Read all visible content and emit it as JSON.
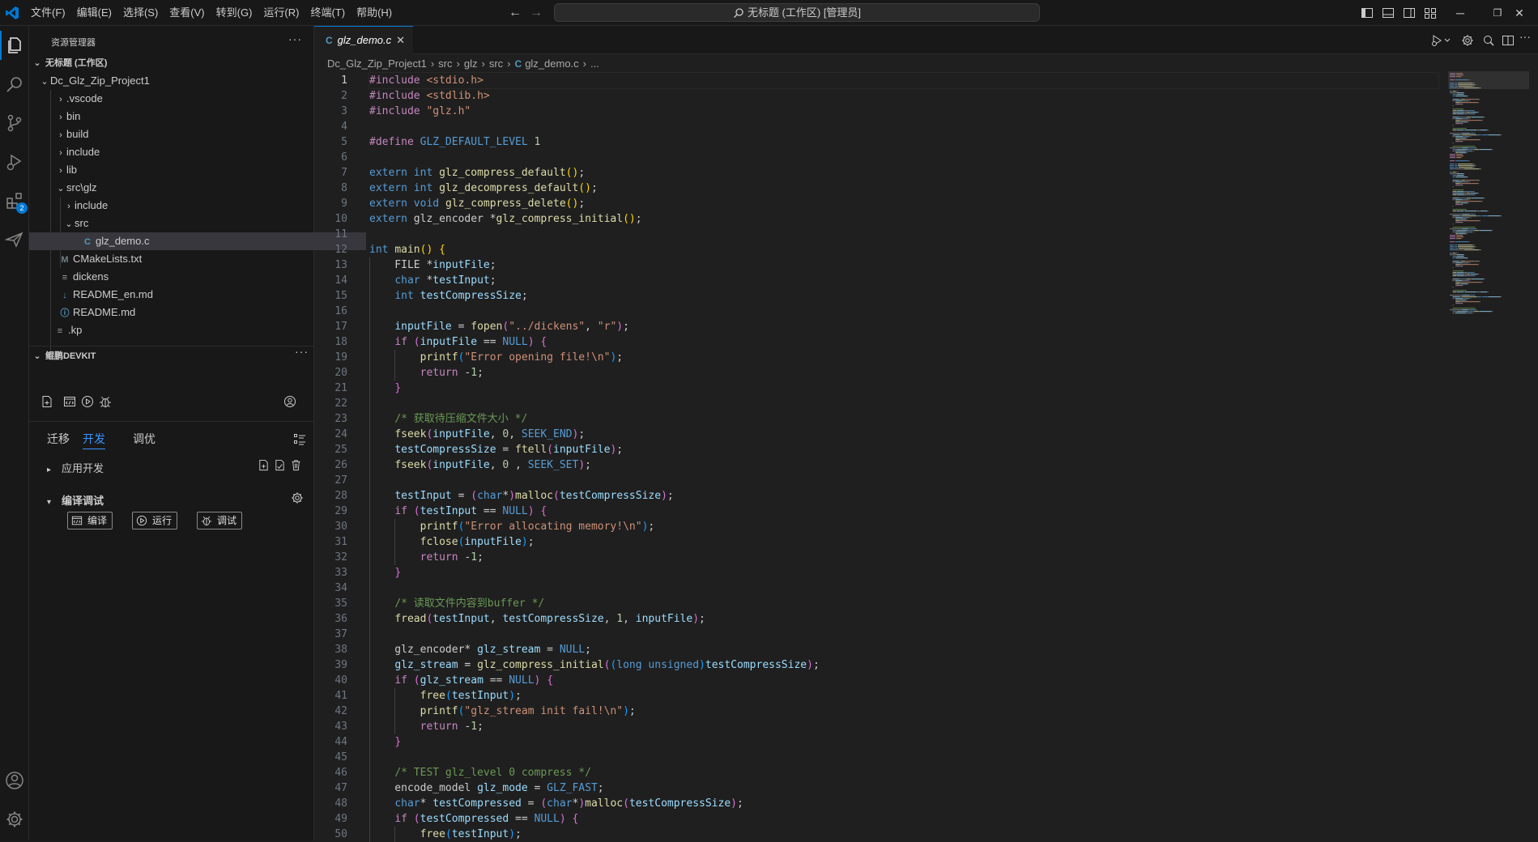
{
  "titlebar": {
    "menus": [
      "文件(F)",
      "编辑(E)",
      "选择(S)",
      "查看(V)",
      "转到(G)",
      "运行(R)",
      "终端(T)",
      "帮助(H)"
    ],
    "command_center": "无标题 (工作区) [管理员]"
  },
  "activitybar": {
    "extensions_badge": "2"
  },
  "explorer": {
    "title": "资源管理器",
    "more": "···",
    "workspace": "无标题 (工作区)",
    "rows": [
      {
        "label": "Dc_Glz_Zip_Project1"
      },
      {
        "label": ".vscode"
      },
      {
        "label": "bin"
      },
      {
        "label": "build"
      },
      {
        "label": "include"
      },
      {
        "label": "lib"
      },
      {
        "label": "src\\glz"
      },
      {
        "label": "include"
      },
      {
        "label": "src"
      },
      {
        "label": "glz_demo.c",
        "icon": "C"
      },
      {
        "label": "CMakeLists.txt",
        "icon": "M"
      },
      {
        "label": "dickens",
        "icon": "≡"
      },
      {
        "label": "README_en.md",
        "icon": "↓"
      },
      {
        "label": "README.md",
        "icon": "ⓘ"
      },
      {
        "label": ".kp",
        "icon": "≡"
      }
    ]
  },
  "devkit": {
    "title": "鲲鹏DEVKIT",
    "more": "···",
    "tabs": [
      "迁移",
      "开发",
      "调优"
    ],
    "app_dev": "应用开发",
    "compile_debug": "编译调试",
    "buttons": {
      "compile": "编译",
      "run": "运行",
      "debug": "调试"
    }
  },
  "editor": {
    "tab_lang": "C",
    "tab_name": "glz_demo.c",
    "tab_close": "✕",
    "breadcrumbs": [
      "Dc_Glz_Zip_Project1",
      "src",
      "glz",
      "src",
      "glz_demo.c",
      "..."
    ],
    "breadcrumb_sep": "›",
    "current_line": 1,
    "line_count": 50
  },
  "colors": {
    "accent": "#0078d4",
    "keyword": "#569cd6",
    "control": "#c586c0",
    "string": "#ce9178",
    "function": "#dcdcaa",
    "comment": "#6a9955",
    "number": "#b5cea8"
  },
  "code": [
    [
      [
        "#include",
        "ct"
      ],
      [
        " ",
        ""
      ],
      [
        "<stdio.h>",
        "str"
      ]
    ],
    [
      [
        "#include",
        "ct"
      ],
      [
        " ",
        ""
      ],
      [
        "<stdlib.h>",
        "str"
      ]
    ],
    [
      [
        "#include",
        "ct"
      ],
      [
        " ",
        ""
      ],
      [
        "\"glz.h\"",
        "str"
      ]
    ],
    [],
    [
      [
        "#define",
        "ct"
      ],
      [
        " ",
        ""
      ],
      [
        "GLZ_DEFAULT_LEVEL",
        "mac"
      ],
      [
        " ",
        ""
      ],
      [
        "1",
        "num"
      ]
    ],
    [],
    [
      [
        "extern",
        "kw"
      ],
      [
        " ",
        ""
      ],
      [
        "int",
        "kw"
      ],
      [
        " ",
        ""
      ],
      [
        "glz_compress_default",
        "fn"
      ],
      [
        "(",
        "b1"
      ],
      [
        ")",
        "b1"
      ],
      [
        ";",
        ""
      ]
    ],
    [
      [
        "extern",
        "kw"
      ],
      [
        " ",
        ""
      ],
      [
        "int",
        "kw"
      ],
      [
        " ",
        ""
      ],
      [
        "glz_decompress_default",
        "fn"
      ],
      [
        "(",
        "b1"
      ],
      [
        ")",
        "b1"
      ],
      [
        ";",
        ""
      ]
    ],
    [
      [
        "extern",
        "kw"
      ],
      [
        " ",
        ""
      ],
      [
        "void",
        "kw"
      ],
      [
        " ",
        ""
      ],
      [
        "glz_compress_delete",
        "fn"
      ],
      [
        "(",
        "b1"
      ],
      [
        ")",
        "b1"
      ],
      [
        ";",
        ""
      ]
    ],
    [
      [
        "extern",
        "kw"
      ],
      [
        " glz_encoder *",
        ""
      ],
      [
        "glz_compress_initial",
        "fn"
      ],
      [
        "(",
        "b1"
      ],
      [
        ")",
        "b1"
      ],
      [
        ";",
        ""
      ]
    ],
    [],
    [
      [
        "int",
        "kw"
      ],
      [
        " ",
        ""
      ],
      [
        "main",
        "fn"
      ],
      [
        "(",
        "b1"
      ],
      [
        ")",
        "b1"
      ],
      [
        " ",
        ""
      ],
      [
        "{",
        "b1"
      ]
    ],
    [
      [
        "    FILE *",
        ""
      ],
      [
        "inputFile",
        "var"
      ],
      [
        ";",
        ""
      ]
    ],
    [
      [
        "    ",
        ""
      ],
      [
        "char",
        "kw"
      ],
      [
        " *",
        ""
      ],
      [
        "testInput",
        "var"
      ],
      [
        ";",
        ""
      ]
    ],
    [
      [
        "    ",
        ""
      ],
      [
        "int",
        "kw"
      ],
      [
        " ",
        ""
      ],
      [
        "testCompressSize",
        "var"
      ],
      [
        ";",
        ""
      ]
    ],
    [],
    [
      [
        "    ",
        ""
      ],
      [
        "inputFile",
        "var"
      ],
      [
        " = ",
        ""
      ],
      [
        "fopen",
        "fn"
      ],
      [
        "(",
        "b2"
      ],
      [
        "\"../dickens\"",
        "str"
      ],
      [
        ", ",
        ""
      ],
      [
        "\"r\"",
        "str"
      ],
      [
        ")",
        "b2"
      ],
      [
        ";",
        ""
      ]
    ],
    [
      [
        "    ",
        ""
      ],
      [
        "if",
        "ct"
      ],
      [
        " ",
        ""
      ],
      [
        "(",
        "b2"
      ],
      [
        "inputFile",
        "var"
      ],
      [
        " == ",
        ""
      ],
      [
        "NULL",
        "kw"
      ],
      [
        ")",
        "b2"
      ],
      [
        " ",
        ""
      ],
      [
        "{",
        "b2"
      ]
    ],
    [
      [
        "        ",
        ""
      ],
      [
        "printf",
        "fn"
      ],
      [
        "(",
        "b3"
      ],
      [
        "\"Error opening file!\\n\"",
        "str"
      ],
      [
        ")",
        "b3"
      ],
      [
        ";",
        ""
      ]
    ],
    [
      [
        "        ",
        ""
      ],
      [
        "return",
        "ct"
      ],
      [
        " -",
        ""
      ],
      [
        "1",
        "num"
      ],
      [
        ";",
        ""
      ]
    ],
    [
      [
        "    ",
        ""
      ],
      [
        "}",
        "b2"
      ]
    ],
    [],
    [
      [
        "    ",
        ""
      ],
      [
        "/* 获取待压缩文件大小 */",
        "cm"
      ]
    ],
    [
      [
        "    ",
        ""
      ],
      [
        "fseek",
        "fn"
      ],
      [
        "(",
        "b2"
      ],
      [
        "inputFile",
        "var"
      ],
      [
        ", ",
        ""
      ],
      [
        "0",
        "num"
      ],
      [
        ", ",
        ""
      ],
      [
        "SEEK_END",
        "mac"
      ],
      [
        ")",
        "b2"
      ],
      [
        ";",
        ""
      ]
    ],
    [
      [
        "    ",
        ""
      ],
      [
        "testCompressSize",
        "var"
      ],
      [
        " = ",
        ""
      ],
      [
        "ftell",
        "fn"
      ],
      [
        "(",
        "b2"
      ],
      [
        "inputFile",
        "var"
      ],
      [
        ")",
        "b2"
      ],
      [
        ";",
        ""
      ]
    ],
    [
      [
        "    ",
        ""
      ],
      [
        "fseek",
        "fn"
      ],
      [
        "(",
        "b2"
      ],
      [
        "inputFile",
        "var"
      ],
      [
        ", ",
        ""
      ],
      [
        "0",
        "num"
      ],
      [
        " , ",
        ""
      ],
      [
        "SEEK_SET",
        "mac"
      ],
      [
        ")",
        "b2"
      ],
      [
        ";",
        ""
      ]
    ],
    [],
    [
      [
        "    ",
        ""
      ],
      [
        "testInput",
        "var"
      ],
      [
        " = ",
        ""
      ],
      [
        "(",
        "b2"
      ],
      [
        "char",
        "kw"
      ],
      [
        "*",
        ""
      ],
      [
        ")",
        "b2"
      ],
      [
        "malloc",
        "fn"
      ],
      [
        "(",
        "b2"
      ],
      [
        "testCompressSize",
        "var"
      ],
      [
        ")",
        "b2"
      ],
      [
        ";",
        ""
      ]
    ],
    [
      [
        "    ",
        ""
      ],
      [
        "if",
        "ct"
      ],
      [
        " ",
        ""
      ],
      [
        "(",
        "b2"
      ],
      [
        "testInput",
        "var"
      ],
      [
        " == ",
        ""
      ],
      [
        "NULL",
        "kw"
      ],
      [
        ")",
        "b2"
      ],
      [
        " ",
        ""
      ],
      [
        "{",
        "b2"
      ]
    ],
    [
      [
        "        ",
        ""
      ],
      [
        "printf",
        "fn"
      ],
      [
        "(",
        "b3"
      ],
      [
        "\"Error allocating memory!\\n\"",
        "str"
      ],
      [
        ")",
        "b3"
      ],
      [
        ";",
        ""
      ]
    ],
    [
      [
        "        ",
        ""
      ],
      [
        "fclose",
        "fn"
      ],
      [
        "(",
        "b3"
      ],
      [
        "inputFile",
        "var"
      ],
      [
        ")",
        "b3"
      ],
      [
        ";",
        ""
      ]
    ],
    [
      [
        "        ",
        ""
      ],
      [
        "return",
        "ct"
      ],
      [
        " -",
        ""
      ],
      [
        "1",
        "num"
      ],
      [
        ";",
        ""
      ]
    ],
    [
      [
        "    ",
        ""
      ],
      [
        "}",
        "b2"
      ]
    ],
    [],
    [
      [
        "    ",
        ""
      ],
      [
        "/* 读取文件内容到buffer */",
        "cm"
      ]
    ],
    [
      [
        "    ",
        ""
      ],
      [
        "fread",
        "fn"
      ],
      [
        "(",
        "b2"
      ],
      [
        "testInput",
        "var"
      ],
      [
        ", ",
        ""
      ],
      [
        "testCompressSize",
        "var"
      ],
      [
        ", ",
        ""
      ],
      [
        "1",
        "num"
      ],
      [
        ", ",
        ""
      ],
      [
        "inputFile",
        "var"
      ],
      [
        ")",
        "b2"
      ],
      [
        ";",
        ""
      ]
    ],
    [],
    [
      [
        "    glz_encoder* ",
        ""
      ],
      [
        "glz_stream",
        "var"
      ],
      [
        " = ",
        ""
      ],
      [
        "NULL",
        "kw"
      ],
      [
        ";",
        ""
      ]
    ],
    [
      [
        "    ",
        ""
      ],
      [
        "glz_stream",
        "var"
      ],
      [
        " = ",
        ""
      ],
      [
        "glz_compress_initial",
        "fn"
      ],
      [
        "(",
        "b2"
      ],
      [
        "(",
        "b3"
      ],
      [
        "long",
        "kw"
      ],
      [
        " ",
        ""
      ],
      [
        "unsigned",
        "kw"
      ],
      [
        ")",
        "b3"
      ],
      [
        "testCompressSize",
        "var"
      ],
      [
        ")",
        "b2"
      ],
      [
        ";",
        ""
      ]
    ],
    [
      [
        "    ",
        ""
      ],
      [
        "if",
        "ct"
      ],
      [
        " ",
        ""
      ],
      [
        "(",
        "b2"
      ],
      [
        "glz_stream",
        "var"
      ],
      [
        " == ",
        ""
      ],
      [
        "NULL",
        "kw"
      ],
      [
        ")",
        "b2"
      ],
      [
        " ",
        ""
      ],
      [
        "{",
        "b2"
      ]
    ],
    [
      [
        "        ",
        ""
      ],
      [
        "free",
        "fn"
      ],
      [
        "(",
        "b3"
      ],
      [
        "testInput",
        "var"
      ],
      [
        ")",
        "b3"
      ],
      [
        ";",
        ""
      ]
    ],
    [
      [
        "        ",
        ""
      ],
      [
        "printf",
        "fn"
      ],
      [
        "(",
        "b3"
      ],
      [
        "\"glz_stream init fail!\\n\"",
        "str"
      ],
      [
        ")",
        "b3"
      ],
      [
        ";",
        ""
      ]
    ],
    [
      [
        "        ",
        ""
      ],
      [
        "return",
        "ct"
      ],
      [
        " -",
        ""
      ],
      [
        "1",
        "num"
      ],
      [
        ";",
        ""
      ]
    ],
    [
      [
        "    ",
        ""
      ],
      [
        "}",
        "b2"
      ]
    ],
    [],
    [
      [
        "    ",
        ""
      ],
      [
        "/* TEST glz_level 0 compress */",
        "cm"
      ]
    ],
    [
      [
        "    encode_model ",
        ""
      ],
      [
        "glz_mode",
        "var"
      ],
      [
        " = ",
        ""
      ],
      [
        "GLZ_FAST",
        "mac"
      ],
      [
        ";",
        ""
      ]
    ],
    [
      [
        "    ",
        ""
      ],
      [
        "char",
        "kw"
      ],
      [
        "* ",
        ""
      ],
      [
        "testCompressed",
        "var"
      ],
      [
        " = ",
        ""
      ],
      [
        "(",
        "b2"
      ],
      [
        "char",
        "kw"
      ],
      [
        "*",
        ""
      ],
      [
        ")",
        "b2"
      ],
      [
        "malloc",
        "fn"
      ],
      [
        "(",
        "b2"
      ],
      [
        "testCompressSize",
        "var"
      ],
      [
        ")",
        "b2"
      ],
      [
        ";",
        ""
      ]
    ],
    [
      [
        "    ",
        ""
      ],
      [
        "if",
        "ct"
      ],
      [
        " ",
        ""
      ],
      [
        "(",
        "b2"
      ],
      [
        "testCompressed",
        "var"
      ],
      [
        " == ",
        ""
      ],
      [
        "NULL",
        "kw"
      ],
      [
        ")",
        "b2"
      ],
      [
        " ",
        ""
      ],
      [
        "{",
        "b2"
      ]
    ],
    [
      [
        "        ",
        ""
      ],
      [
        "free",
        "fn"
      ],
      [
        "(",
        "b3"
      ],
      [
        "testInput",
        "var"
      ],
      [
        ")",
        "b3"
      ],
      [
        ";",
        ""
      ]
    ]
  ]
}
